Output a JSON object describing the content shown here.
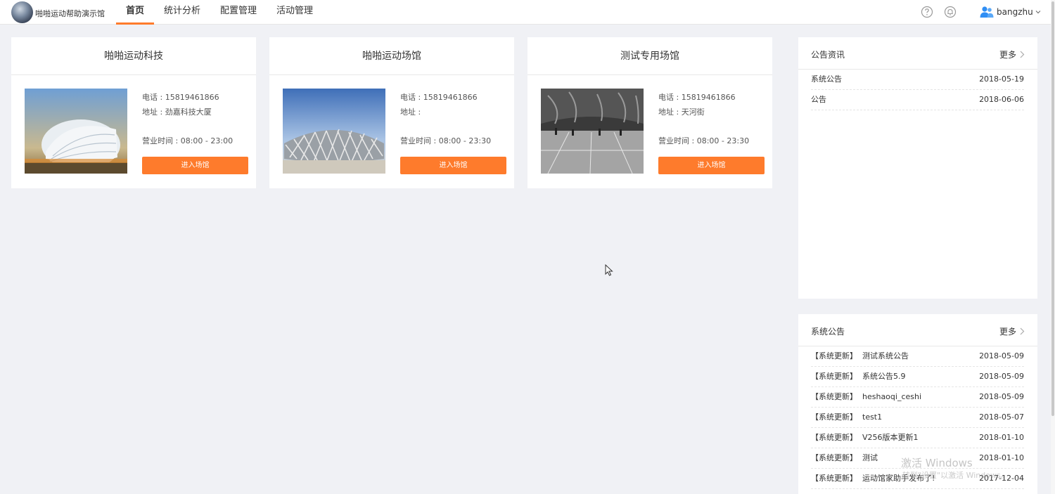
{
  "app": {
    "name": "啪啪运动帮助演示馆"
  },
  "nav": [
    {
      "label": "首页",
      "active": true
    },
    {
      "label": "统计分析"
    },
    {
      "label": "配置管理"
    },
    {
      "label": "活动管理"
    }
  ],
  "header": {
    "help_icon": "help-circle-icon",
    "bell_icon": "bell-icon",
    "user_icon": "users-icon",
    "username": "bangzhu"
  },
  "venues": [
    {
      "name": "啪啪运动科技",
      "phone": "电话 : 15819461866",
      "address": "地址 : 劲嘉科技大厦",
      "hours": "营业时间 : 08:00 - 23:00",
      "button": "进入场馆"
    },
    {
      "name": "啪啪运动场馆",
      "phone": "电话 : 15819461866",
      "address": "地址 :",
      "hours": "营业时间 : 08:00 - 23:30",
      "button": "进入场馆"
    },
    {
      "name": "测试专用场馆",
      "phone": "电话 : 15819461866",
      "address": "地址 : 天河街",
      "hours": "营业时间 : 08:00 - 23:30",
      "button": "进入场馆"
    }
  ],
  "news_panel": {
    "title": "公告资讯",
    "more": "更多",
    "items": [
      {
        "title": "系统公告",
        "date": "2018-05-19"
      },
      {
        "title": "公告",
        "date": "2018-06-06"
      }
    ]
  },
  "system_panel": {
    "title": "系统公告",
    "more": "更多",
    "items": [
      {
        "tag": "【系统更新】",
        "title": "测试系统公告",
        "date": "2018-05-09"
      },
      {
        "tag": "【系统更新】",
        "title": "系统公告5.9",
        "date": "2018-05-09"
      },
      {
        "tag": "【系统更新】",
        "title": "heshaoqi_ceshi",
        "date": "2018-05-09"
      },
      {
        "tag": "【系统更新】",
        "title": "test1",
        "date": "2018-05-07"
      },
      {
        "tag": "【系统更新】",
        "title": "V256版本更新1",
        "date": "2018-01-10"
      },
      {
        "tag": "【系统更新】",
        "title": "测试",
        "date": "2018-01-10"
      },
      {
        "tag": "【系统更新】",
        "title": "运动馆家助手发布了!",
        "date": "2017-12-04"
      }
    ]
  },
  "watermark": {
    "line1": "激活 Windows",
    "line2": "转到\"设置\"以激活 Windows。"
  }
}
